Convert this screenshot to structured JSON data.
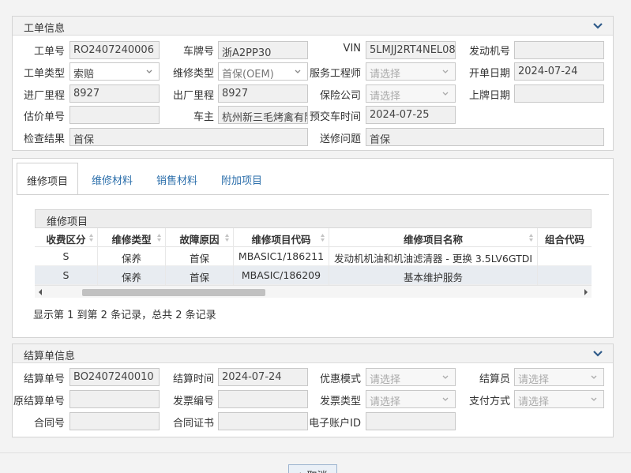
{
  "work_order": {
    "title": "工单信息",
    "fields": {
      "order_no": {
        "label": "工单号",
        "value": "RO2407240006"
      },
      "plate_no": {
        "label": "车牌号",
        "value": "浙A2PP30"
      },
      "vin": {
        "label": "VIN",
        "value": "5LMJJ2RT4NEL08"
      },
      "engine_no": {
        "label": "发动机号",
        "value": ""
      },
      "order_type": {
        "label": "工单类型",
        "value": "索赔"
      },
      "repair_type": {
        "label": "维修类型",
        "value": "首保(OEM)"
      },
      "service_engineer": {
        "label": "服务工程师",
        "placeholder": "请选择"
      },
      "open_date": {
        "label": "开单日期",
        "value": "2024-07-24"
      },
      "in_mileage": {
        "label": "进厂里程",
        "value": "8927"
      },
      "out_mileage": {
        "label": "出厂里程",
        "value": "8927"
      },
      "insurance_company": {
        "label": "保险公司",
        "placeholder": "请选择"
      },
      "register_date": {
        "label": "上牌日期",
        "value": ""
      },
      "estimate_no": {
        "label": "估价单号",
        "value": ""
      },
      "owner": {
        "label": "车主",
        "value": "杭州新三毛烤禽有限"
      },
      "delivery_time": {
        "label": "预交车时间",
        "value": "2024-07-25"
      },
      "inspection_result": {
        "label": "检查结果",
        "value": "首保"
      },
      "repair_issue": {
        "label": "送修问题",
        "value": "首保"
      }
    }
  },
  "tabs": [
    "维修项目",
    "维修材料",
    "销售材料",
    "附加项目"
  ],
  "grid": {
    "caption": "维修项目",
    "columns": [
      "收费区分",
      "维修类型",
      "故障原因",
      "维修项目代码",
      "维修项目名称",
      "组合代码"
    ],
    "rows": [
      [
        "S",
        "保养",
        "首保",
        "MBASIC1/186211",
        "发动机机油和机油滤清器 - 更换 3.5LV6GTDI",
        ""
      ],
      [
        "S",
        "保养",
        "首保",
        "MBASIC/186209",
        "基本维护服务",
        ""
      ]
    ],
    "pager_text": "显示第 1 到第 2 条记录，总共 2 条记录"
  },
  "settlement": {
    "title": "结算单信息",
    "fields": {
      "settle_no": {
        "label": "结算单号",
        "value": "BO2407240010"
      },
      "settle_time": {
        "label": "结算时间",
        "value": "2024-07-24"
      },
      "discount_mode": {
        "label": "优惠模式",
        "placeholder": "请选择"
      },
      "settler": {
        "label": "结算员",
        "placeholder": "请选择"
      },
      "orig_settle_no": {
        "label": "原结算单号",
        "value": ""
      },
      "invoice_no": {
        "label": "发票编号",
        "value": ""
      },
      "invoice_type": {
        "label": "发票类型",
        "placeholder": "请选择"
      },
      "payment_method": {
        "label": "支付方式",
        "placeholder": "请选择"
      },
      "contract_no": {
        "label": "合同号",
        "value": ""
      },
      "contract_cert": {
        "label": "合同证书",
        "value": ""
      },
      "e_account_id": {
        "label": "电子账户ID",
        "value": ""
      }
    }
  },
  "buttons": {
    "cancel": "取消"
  },
  "icons": {
    "collapse": "chevron-down-icon",
    "sort": "sort-icon",
    "cancel": "undo-icon"
  },
  "colors": {
    "tab_text": "#2c6fab",
    "row_alt": "#e8ecf1",
    "panel_head": "#f2f2f2"
  }
}
